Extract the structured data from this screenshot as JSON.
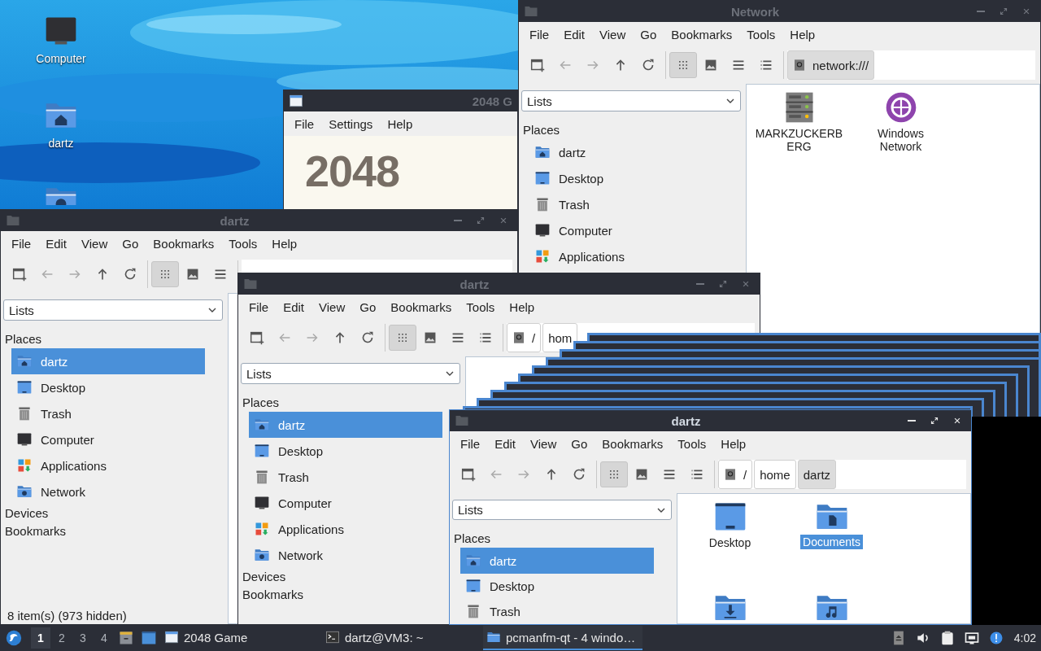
{
  "desktop_icons": [
    {
      "label": "Computer",
      "kind": "computer"
    },
    {
      "label": "dartz",
      "kind": "home"
    },
    {
      "kind": "network"
    }
  ],
  "windows": [
    {
      "kind": "game",
      "title": "2048 G",
      "active": false,
      "menu": [
        "File",
        "Settings",
        "Help"
      ],
      "heading": "2048"
    },
    {
      "kind": "file-manager",
      "title": "Network",
      "active": false,
      "menu": [
        "File",
        "Edit",
        "View",
        "Go",
        "Bookmarks",
        "Tools",
        "Help"
      ],
      "view_modes": [
        {
          "kind": "icons",
          "selected": true
        },
        {
          "kind": "thumbnails",
          "selected": false
        },
        {
          "kind": "compact",
          "selected": false
        },
        {
          "kind": "details",
          "selected": false
        }
      ],
      "location": [
        {
          "label": "network:///",
          "selected": true
        }
      ],
      "view_selector": "Lists",
      "sidebar": [
        {
          "heading": "Places",
          "items": [
            {
              "label": "dartz",
              "kind": "home",
              "selected": false
            },
            {
              "label": "Desktop",
              "kind": "desktop",
              "selected": false
            },
            {
              "label": "Trash",
              "kind": "trash",
              "selected": false
            },
            {
              "label": "Computer",
              "kind": "computer",
              "selected": false
            },
            {
              "label": "Applications",
              "kind": "apps",
              "selected": false
            }
          ]
        }
      ],
      "items": [
        {
          "label": "MARKZUCKERBERG",
          "kind": "server",
          "selected": false
        },
        {
          "label": "Windows Network",
          "kind": "globe",
          "selected": false
        }
      ]
    },
    {
      "kind": "file-manager",
      "title": "dartz",
      "active": false,
      "menu": [
        "File",
        "Edit",
        "View",
        "Go",
        "Bookmarks",
        "Tools",
        "Help"
      ],
      "view_modes": [
        {
          "kind": "icons",
          "selected": true
        },
        {
          "kind": "thumbnails",
          "selected": false
        },
        {
          "kind": "compact",
          "selected": false
        }
      ],
      "view_selector": "Lists",
      "sidebar": [
        {
          "heading": "Places",
          "items": [
            {
              "label": "dartz",
              "kind": "home",
              "selected": true
            },
            {
              "label": "Desktop",
              "kind": "desktop",
              "selected": false
            },
            {
              "label": "Trash",
              "kind": "trash",
              "selected": false
            },
            {
              "label": "Computer",
              "kind": "computer",
              "selected": false
            },
            {
              "label": "Applications",
              "kind": "apps",
              "selected": false
            },
            {
              "label": "Network",
              "kind": "network",
              "selected": false
            }
          ]
        },
        {
          "heading": "Devices"
        },
        {
          "heading": "Bookmarks"
        }
      ],
      "status": "8 item(s) (973 hidden)"
    },
    {
      "kind": "file-manager",
      "title": "dartz",
      "active": false,
      "menu": [
        "File",
        "Edit",
        "View",
        "Go",
        "Bookmarks",
        "Tools",
        "Help"
      ],
      "view_modes": [
        {
          "kind": "icons",
          "selected": true
        },
        {
          "kind": "thumbnails",
          "selected": false
        },
        {
          "kind": "compact",
          "selected": false
        },
        {
          "kind": "details",
          "selected": false
        }
      ],
      "location": [
        {
          "label": "/",
          "selected": false
        },
        {
          "label": "hom",
          "selected": false
        }
      ],
      "view_selector": "Lists",
      "sidebar": [
        {
          "heading": "Places",
          "items": [
            {
              "label": "dartz",
              "kind": "home",
              "selected": true
            },
            {
              "label": "Desktop",
              "kind": "desktop",
              "selected": false
            },
            {
              "label": "Trash",
              "kind": "trash",
              "selected": false
            },
            {
              "label": "Computer",
              "kind": "computer",
              "selected": false
            },
            {
              "label": "Applications",
              "kind": "apps",
              "selected": false
            },
            {
              "label": "Network",
              "kind": "network",
              "selected": false
            }
          ]
        },
        {
          "heading": "Devices"
        },
        {
          "heading": "Bookmarks"
        }
      ]
    },
    {
      "kind": "file-manager",
      "title": "dartz",
      "active": true,
      "menu": [
        "File",
        "Edit",
        "View",
        "Go",
        "Bookmarks",
        "Tools",
        "Help"
      ],
      "view_modes": [
        {
          "kind": "icons",
          "selected": true
        },
        {
          "kind": "thumbnails",
          "selected": false
        },
        {
          "kind": "compact",
          "selected": false
        },
        {
          "kind": "details",
          "selected": false
        }
      ],
      "location": [
        {
          "label": "/",
          "selected": false
        },
        {
          "label": "home",
          "selected": false
        },
        {
          "label": "dartz",
          "selected": true
        }
      ],
      "view_selector": "Lists",
      "sidebar": [
        {
          "heading": "Places",
          "items": [
            {
              "label": "dartz",
              "kind": "home",
              "selected": true
            },
            {
              "label": "Desktop",
              "kind": "desktop",
              "selected": false
            },
            {
              "label": "Trash",
              "kind": "trash",
              "selected": false
            }
          ]
        }
      ],
      "items": [
        {
          "label": "Desktop",
          "kind": "desktop",
          "selected": false
        },
        {
          "label": "Documents",
          "kind": "documents",
          "selected": true
        },
        {
          "kind": "downloads"
        },
        {
          "kind": "music"
        }
      ]
    }
  ],
  "taskbar": {
    "workspaces": [
      {
        "label": "1",
        "selected": true
      },
      {
        "label": "2",
        "selected": false
      },
      {
        "label": "3",
        "selected": false
      },
      {
        "label": "4",
        "selected": false
      }
    ],
    "tasks": [
      {
        "label": "2048 Game",
        "kind": "game",
        "selected": false
      },
      {
        "label": "dartz@VM3: ~",
        "kind": "terminal",
        "selected": false
      },
      {
        "label": "pcmanfm-qt - 4 windo…",
        "kind": "folder",
        "selected": true
      }
    ],
    "clock": "4:02"
  }
}
